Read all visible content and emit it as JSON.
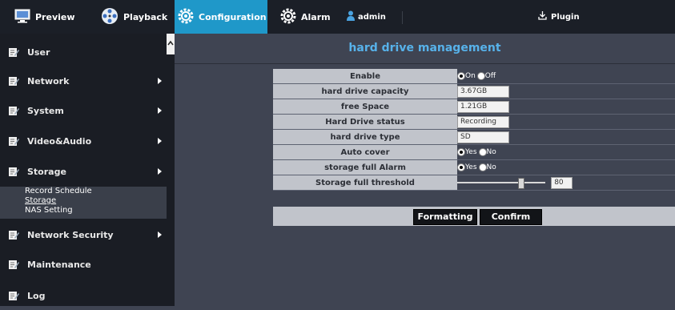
{
  "topbar": {
    "tabs": [
      {
        "label": "Preview",
        "icon": "monitor-icon"
      },
      {
        "label": "Playback",
        "icon": "film-reel-icon"
      },
      {
        "label": "Configuration",
        "icon": "gear-icon",
        "active": true
      },
      {
        "label": "Alarm",
        "icon": "gear-icon"
      }
    ],
    "user": {
      "label": "admin",
      "icon": "user-icon"
    },
    "plugin": {
      "label": "Plugin",
      "icon": "download-icon"
    }
  },
  "sidebar": {
    "items": [
      {
        "label": "User",
        "has_arrow": false
      },
      {
        "label": "Network",
        "has_arrow": true
      },
      {
        "label": "System",
        "has_arrow": true
      },
      {
        "label": "Video&Audio",
        "has_arrow": true
      },
      {
        "label": "Storage",
        "has_arrow": true
      },
      {
        "label": "Network Security",
        "has_arrow": true
      },
      {
        "label": "Maintenance",
        "has_arrow": false
      },
      {
        "label": "Log",
        "has_arrow": false
      }
    ],
    "submenu": [
      {
        "label": "Record Schedule",
        "current": false
      },
      {
        "label": "Storage",
        "current": true
      },
      {
        "label": "NAS Setting",
        "current": false
      }
    ]
  },
  "content": {
    "title": "hard drive management",
    "enable": {
      "label": "Enable",
      "on_label": "On",
      "off_label": "Off",
      "value": "On"
    },
    "capacity": {
      "label": "hard drive capacity",
      "value": "3.67GB"
    },
    "free_space": {
      "label": "free Space",
      "value": "1.21GB"
    },
    "status": {
      "label": "Hard Drive status",
      "value": "Recording"
    },
    "type": {
      "label": "hard drive type",
      "value": "SD"
    },
    "auto_cover": {
      "label": "Auto cover",
      "yes_label": "Yes",
      "no_label": "No",
      "value": "Yes"
    },
    "full_alarm": {
      "label": "storage full Alarm",
      "yes_label": "Yes",
      "no_label": "No",
      "value": "Yes"
    },
    "threshold": {
      "label": "Storage full threshold",
      "value": "80",
      "slider_fraction": 0.8
    },
    "buttons": {
      "format": "Formatting",
      "confirm": "Confirm"
    }
  },
  "colors": {
    "accent": "#1f98c9",
    "title": "#57b2ea",
    "sidebar_bg": "#1a1d24",
    "content_bg": "#3f4452"
  }
}
